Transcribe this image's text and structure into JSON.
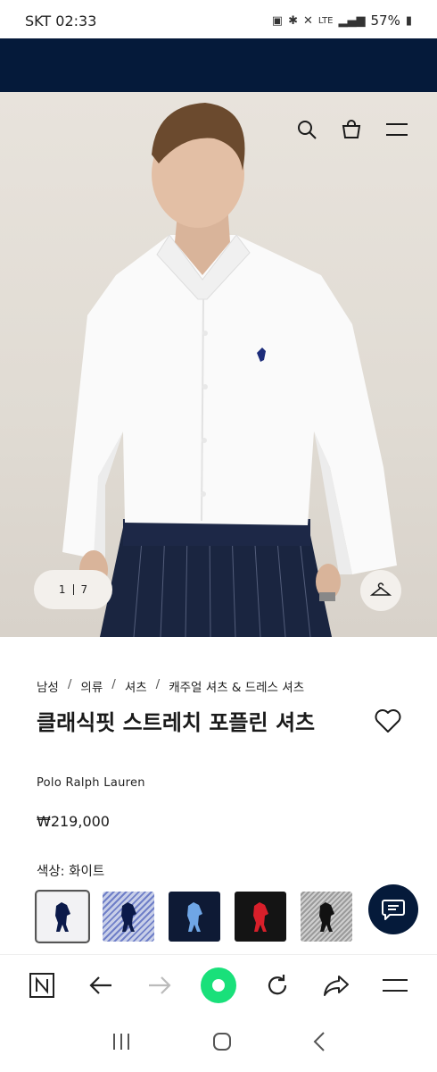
{
  "status": {
    "carrier_time": "SKT 02:33",
    "network": "LTE",
    "battery": "57%"
  },
  "hero": {
    "counter_current": "1",
    "counter_total": "7",
    "icons": [
      "search-icon",
      "bag-icon",
      "menu-icon",
      "hanger-icon"
    ]
  },
  "breadcrumb": [
    "남성",
    "의류",
    "셔츠",
    "캐주얼 셔츠 & 드레스 셔츠"
  ],
  "product": {
    "title": "클래식핏 스트레치 포플린 셔츠",
    "brand": "Polo Ralph Lauren",
    "price": "₩219,000",
    "color_label": "색상: 화이트"
  },
  "swatches": [
    {
      "name": "white",
      "bg": "#f2f2f4",
      "pony": "#0b1a4a"
    },
    {
      "name": "blue-stripe",
      "bg": "#8a97d4",
      "pony": "#0b1a4a"
    },
    {
      "name": "navy",
      "bg": "#0e1a35",
      "pony": "#6fa6e6"
    },
    {
      "name": "black",
      "bg": "#141414",
      "pony": "#d81f2a"
    },
    {
      "name": "grey-stripe",
      "bg": "#b4b4b4",
      "pony": "#111111"
    }
  ],
  "colors": {
    "navy": "#051a3a",
    "green": "#19e07a"
  }
}
